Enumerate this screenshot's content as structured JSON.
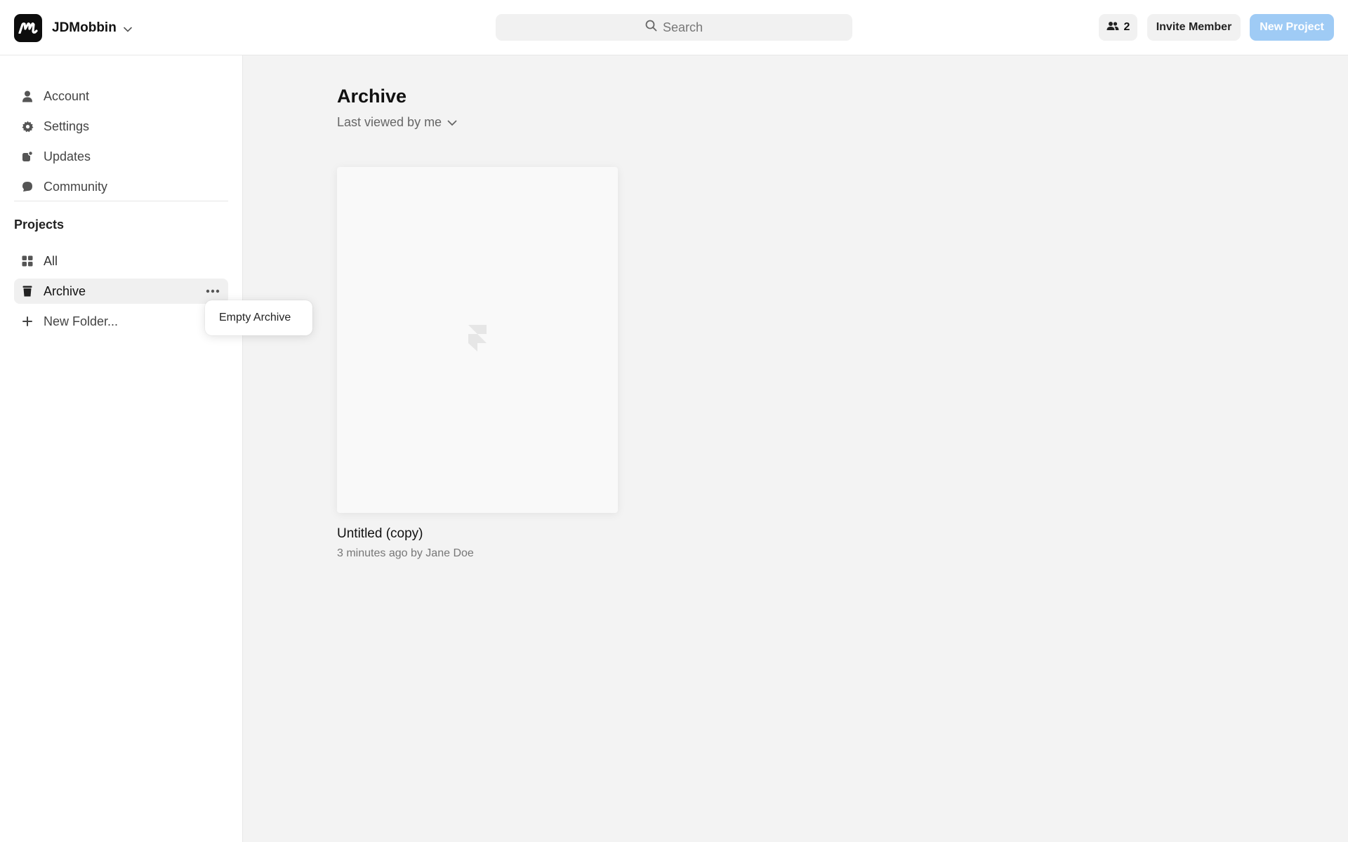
{
  "header": {
    "workspace_name": "JDMobbin",
    "search_placeholder": "Search",
    "members_count": "2",
    "invite_label": "Invite Member",
    "new_project_label": "New Project",
    "colors": {
      "new_project_bg": "#9fcbf5"
    }
  },
  "sidebar": {
    "nav": [
      {
        "label": "Account",
        "icon": "user-icon"
      },
      {
        "label": "Settings",
        "icon": "gear-icon"
      },
      {
        "label": "Updates",
        "icon": "updates-icon"
      },
      {
        "label": "Community",
        "icon": "chat-bubble-icon"
      }
    ],
    "projects_title": "Projects",
    "projects": [
      {
        "label": "All",
        "icon": "grid-icon"
      },
      {
        "label": "Archive",
        "icon": "trash-icon",
        "active": true
      },
      {
        "label": "New Folder...",
        "icon": "plus-icon"
      }
    ]
  },
  "context_menu": {
    "items": [
      {
        "label": "Empty Archive"
      }
    ]
  },
  "main": {
    "title": "Archive",
    "sort_label": "Last viewed by me",
    "projects": [
      {
        "title": "Untitled (copy)",
        "meta": "3 minutes ago by Jane Doe",
        "thumbnail_icon": "framer-logo-icon"
      }
    ]
  }
}
